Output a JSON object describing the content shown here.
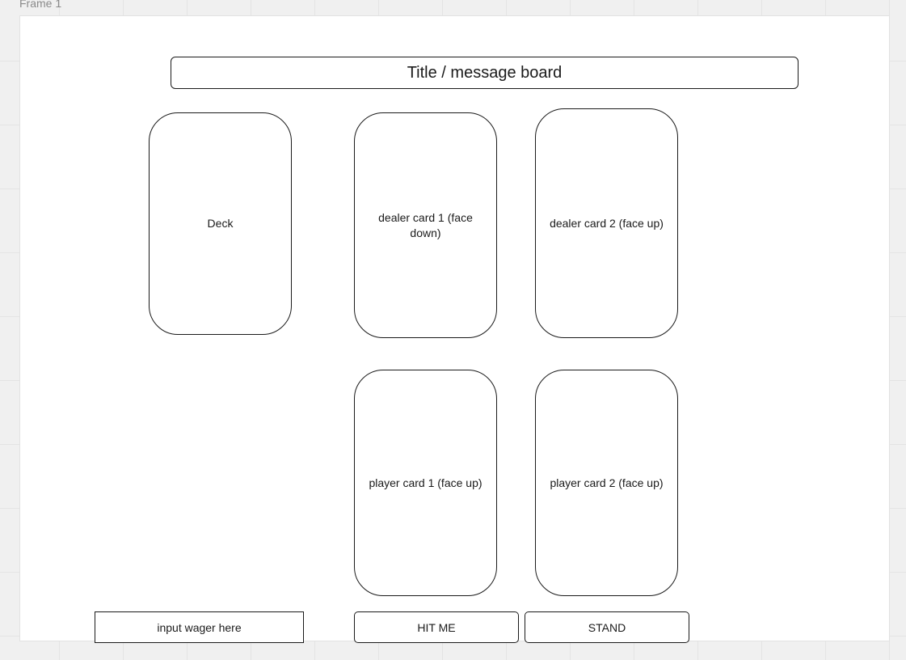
{
  "frame": {
    "label": "Frame 1"
  },
  "title_board": {
    "text": "Title / message board"
  },
  "deck": {
    "label": "Deck"
  },
  "dealer": {
    "card1_label": "dealer card 1 (face down)",
    "card2_label": "dealer card 2 (face up)"
  },
  "player": {
    "card1_label": "player card 1 (face up)",
    "card2_label": "player card 2 (face up)"
  },
  "controls": {
    "wager_placeholder": "input wager here",
    "hit_label": "HIT ME",
    "stand_label": "STAND"
  },
  "colors": {
    "stroke": "#1a1a1a",
    "canvas": "#f0f0f0",
    "frame": "#ffffff"
  }
}
